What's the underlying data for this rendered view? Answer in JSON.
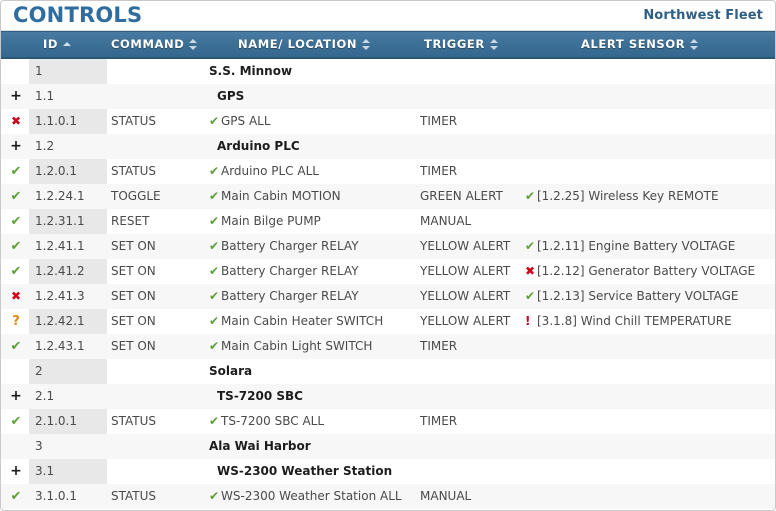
{
  "app": {
    "title": "CONTROLS",
    "fleet": "Northwest Fleet"
  },
  "columns": [
    {
      "key": "id",
      "label": "ID",
      "sort": "asc"
    },
    {
      "key": "cmd",
      "label": "COMMAND",
      "sort": "both"
    },
    {
      "key": "name",
      "label": "NAME/ LOCATION",
      "sort": "both"
    },
    {
      "key": "trig",
      "label": "TRIGGER",
      "sort": "both"
    },
    {
      "key": "alert",
      "label": "ALERT SENSOR",
      "sort": "both"
    }
  ],
  "icons": {
    "ok": "✔",
    "bad": "✖",
    "warn": "?",
    "exclaim": "!",
    "expand": "+",
    "sort-asc": "sort-ascending-icon",
    "sort-both": "sort-both-icon"
  },
  "colors": {
    "header_bar": "#3c6f96",
    "title": "#2f6d9e",
    "ok_green": "#5d9e38",
    "bad_red": "#d0021b",
    "warn_orange": "#e08a17",
    "id_band": "#e8e8e8",
    "row_alt": "#f7f7f7"
  },
  "rows": [
    {
      "status": "",
      "id": "1",
      "cmd": "",
      "name": "S.S. Minnow",
      "name_icon": "",
      "group": true,
      "indent": 0,
      "trig": "",
      "alert": "",
      "alert_icon": "",
      "band": true
    },
    {
      "status": "plus",
      "id": "1.1",
      "cmd": "",
      "name": "GPS",
      "name_icon": "",
      "group": true,
      "indent": 1,
      "trig": "",
      "alert": "",
      "alert_icon": "",
      "band": false
    },
    {
      "status": "bad",
      "id": "1.1.0.1",
      "cmd": "STATUS",
      "name": "GPS ALL",
      "name_icon": "ok",
      "group": false,
      "indent": 0,
      "trig": "TIMER",
      "alert": "",
      "alert_icon": "",
      "band": true
    },
    {
      "status": "plus",
      "id": "1.2",
      "cmd": "",
      "name": "Arduino PLC",
      "name_icon": "",
      "group": true,
      "indent": 1,
      "trig": "",
      "alert": "",
      "alert_icon": "",
      "band": false
    },
    {
      "status": "ok",
      "id": "1.2.0.1",
      "cmd": "STATUS",
      "name": "Arduino PLC ALL",
      "name_icon": "ok",
      "group": false,
      "indent": 0,
      "trig": "TIMER",
      "alert": "",
      "alert_icon": "",
      "band": true
    },
    {
      "status": "ok",
      "id": "1.2.24.1",
      "cmd": "TOGGLE",
      "name": "Main Cabin MOTION",
      "name_icon": "ok",
      "group": false,
      "indent": 0,
      "trig": "GREEN ALERT",
      "alert": "[1.2.25] Wireless Key REMOTE",
      "alert_icon": "ok",
      "band": false
    },
    {
      "status": "ok",
      "id": "1.2.31.1",
      "cmd": "RESET",
      "name": "Main Bilge PUMP",
      "name_icon": "ok",
      "group": false,
      "indent": 0,
      "trig": "MANUAL",
      "alert": "",
      "alert_icon": "",
      "band": true
    },
    {
      "status": "ok",
      "id": "1.2.41.1",
      "cmd": "SET ON",
      "name": "Battery Charger RELAY",
      "name_icon": "ok",
      "group": false,
      "indent": 0,
      "trig": "YELLOW ALERT",
      "alert": "[1.2.11] Engine Battery VOLTAGE",
      "alert_icon": "ok",
      "band": false
    },
    {
      "status": "ok",
      "id": "1.2.41.2",
      "cmd": "SET ON",
      "name": "Battery Charger RELAY",
      "name_icon": "ok",
      "group": false,
      "indent": 0,
      "trig": "YELLOW ALERT",
      "alert": "[1.2.12] Generator Battery VOLTAGE",
      "alert_icon": "bad",
      "band": true
    },
    {
      "status": "bad",
      "id": "1.2.41.3",
      "cmd": "SET ON",
      "name": "Battery Charger RELAY",
      "name_icon": "ok",
      "group": false,
      "indent": 0,
      "trig": "YELLOW ALERT",
      "alert": "[1.2.13] Service Battery VOLTAGE",
      "alert_icon": "ok",
      "band": false
    },
    {
      "status": "warn",
      "id": "1.2.42.1",
      "cmd": "SET ON",
      "name": "Main Cabin Heater SWITCH",
      "name_icon": "ok",
      "group": false,
      "indent": 0,
      "trig": "YELLOW ALERT",
      "alert": "[3.1.8] Wind Chill TEMPERATURE",
      "alert_icon": "exclaim",
      "band": true
    },
    {
      "status": "ok",
      "id": "1.2.43.1",
      "cmd": "SET ON",
      "name": "Main Cabin Light SWITCH",
      "name_icon": "ok",
      "group": false,
      "indent": 0,
      "trig": "TIMER",
      "alert": "",
      "alert_icon": "",
      "band": false
    },
    {
      "status": "",
      "id": "2",
      "cmd": "",
      "name": "Solara",
      "name_icon": "",
      "group": true,
      "indent": 0,
      "trig": "",
      "alert": "",
      "alert_icon": "",
      "band": true
    },
    {
      "status": "plus",
      "id": "2.1",
      "cmd": "",
      "name": "TS-7200 SBC",
      "name_icon": "",
      "group": true,
      "indent": 1,
      "trig": "",
      "alert": "",
      "alert_icon": "",
      "band": false
    },
    {
      "status": "ok",
      "id": "2.1.0.1",
      "cmd": "STATUS",
      "name": "TS-7200 SBC ALL",
      "name_icon": "ok",
      "group": false,
      "indent": 0,
      "trig": "TIMER",
      "alert": "",
      "alert_icon": "",
      "band": true
    },
    {
      "status": "",
      "id": "3",
      "cmd": "",
      "name": "Ala Wai Harbor",
      "name_icon": "",
      "group": true,
      "indent": 0,
      "trig": "",
      "alert": "",
      "alert_icon": "",
      "band": false
    },
    {
      "status": "plus",
      "id": "3.1",
      "cmd": "",
      "name": "WS-2300 Weather Station",
      "name_icon": "",
      "group": true,
      "indent": 1,
      "trig": "",
      "alert": "",
      "alert_icon": "",
      "band": true
    },
    {
      "status": "ok",
      "id": "3.1.0.1",
      "cmd": "STATUS",
      "name": "WS-2300 Weather Station ALL",
      "name_icon": "ok",
      "group": false,
      "indent": 0,
      "trig": "MANUAL",
      "alert": "",
      "alert_icon": "",
      "band": false
    }
  ]
}
